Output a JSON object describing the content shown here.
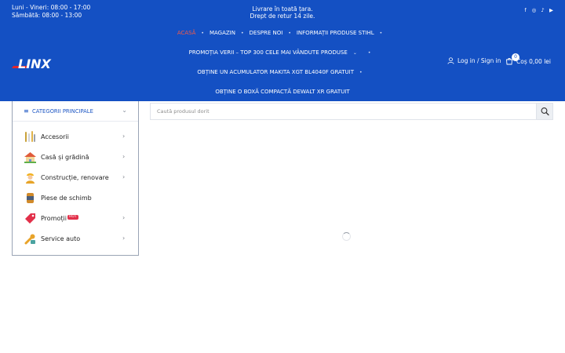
{
  "topbar": {
    "hours_weekday": "Luni - Vineri: 08:00 - 17:00",
    "hours_saturday": "Sâmbătă: 08:00 - 13:00",
    "delivery_line1": "Livrare în toată țara.",
    "delivery_line2": "Drept de retur 14 zile.",
    "social_icons": [
      "facebook-icon",
      "instagram-icon",
      "tiktok-icon",
      "youtube-icon"
    ]
  },
  "brand": {
    "name": "LINX"
  },
  "nav": {
    "row1": [
      "ACASĂ",
      "MAGAZIN",
      "DESPRE NOI",
      "INFORMAȚII PRODUSE STIHL"
    ],
    "row2": "PROMOȚIA VERII – TOP 300 CELE MAI VÂNDUTE PRODUSE",
    "row3": "OBȚINE UN ACUMULATOR MAKITA XGT BL4040F GRATUIT",
    "row4": "OBȚINE O BOXĂ COMPACTĂ DEWALT XR GRATUIT",
    "separator": "•"
  },
  "account": {
    "label": "Log in / Sign in"
  },
  "cart": {
    "count": "0",
    "label": "Coș",
    "total": "0,00 lei"
  },
  "categories": {
    "title": "CATEGORII PRINCIPALE",
    "items": [
      {
        "label": "Accesorii",
        "icon": "tools-icon",
        "has_sub": true
      },
      {
        "label": "Casă și grădină",
        "icon": "house-icon",
        "has_sub": true
      },
      {
        "label": "Construcție, renovare",
        "icon": "worker-icon",
        "has_sub": true
      },
      {
        "label": "Piese de schimb",
        "icon": "parts-icon",
        "has_sub": false
      },
      {
        "label": "Promoții",
        "icon": "tag-icon",
        "has_sub": true,
        "badge": "HOT"
      },
      {
        "label": "Service auto",
        "icon": "wrench-icon",
        "has_sub": true
      }
    ]
  },
  "search": {
    "placeholder": "Caută produsul dorit"
  },
  "colors": {
    "brand_blue": "#1450c3",
    "active_nav": "#f25a4a",
    "hot_badge": "#e2304a"
  }
}
